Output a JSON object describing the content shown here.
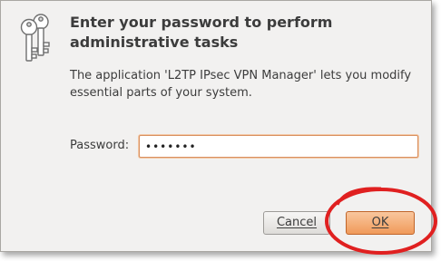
{
  "dialog": {
    "title": "Enter your password to perform administrative tasks",
    "description": "The application 'L2TP IPsec VPN Manager' lets you modify essential parts of your system.",
    "icon": "keys-icon"
  },
  "password": {
    "label": "Password:",
    "value": "•••••••"
  },
  "buttons": {
    "cancel_label": "Cancel",
    "ok_label": "OK"
  },
  "colors": {
    "dialog_bg": "#f2f1f0",
    "ok_button": "#f09a5a",
    "input_focus_border": "#d99060",
    "annotation_ring": "#e02020"
  }
}
